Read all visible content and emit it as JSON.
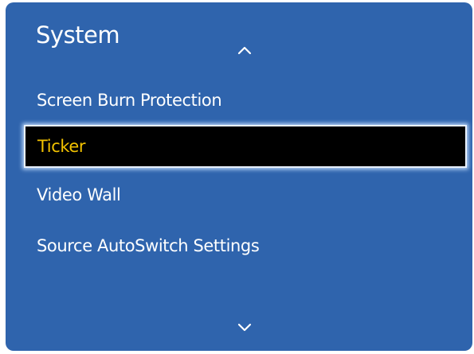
{
  "header": {
    "title": "System"
  },
  "icons": {
    "scroll_up": "chevron-up-icon",
    "scroll_down": "chevron-down-icon"
  },
  "menu": {
    "items": [
      {
        "label": "Screen Burn Protection"
      },
      {
        "label": "Ticker",
        "selected": true
      },
      {
        "label": "Video Wall"
      },
      {
        "label": "Source AutoSwitch Settings"
      }
    ]
  },
  "colors": {
    "panel_background": "#2f64ad",
    "text": "#ffffff",
    "selected_background": "#000000",
    "selected_text": "#f2c200",
    "selected_border": "#e9f1ff"
  }
}
